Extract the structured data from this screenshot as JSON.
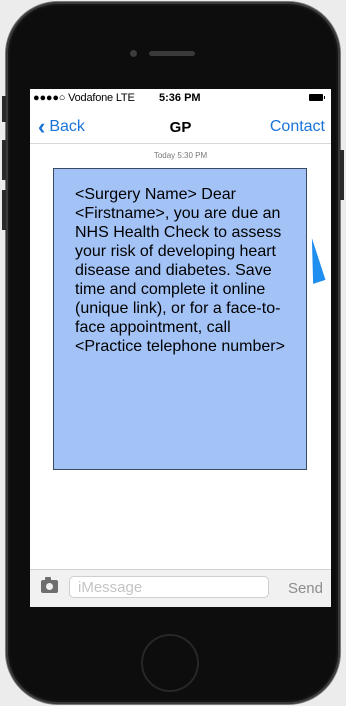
{
  "status_bar": {
    "carrier": "●●●●○ Vodafone LTE",
    "time": "5:36 PM"
  },
  "nav": {
    "back_label": "Back",
    "title": "GP",
    "contact_label": "Contact"
  },
  "conversation": {
    "timestamp": "Today 5:30 PM",
    "message": "<Surgery Name> Dear <Firstname>, you are due an NHS Health Check to assess your risk of developing heart disease and diabetes. Save time and complete it online (unique link), or for a face-to-face appointment, call <Practice telephone number>"
  },
  "input_bar": {
    "placeholder": "iMessage",
    "send_label": "Send"
  },
  "colors": {
    "accent": "#1a73d9",
    "bubble": "#a3c3f7",
    "bubble_tail": "#1f8ef1"
  }
}
